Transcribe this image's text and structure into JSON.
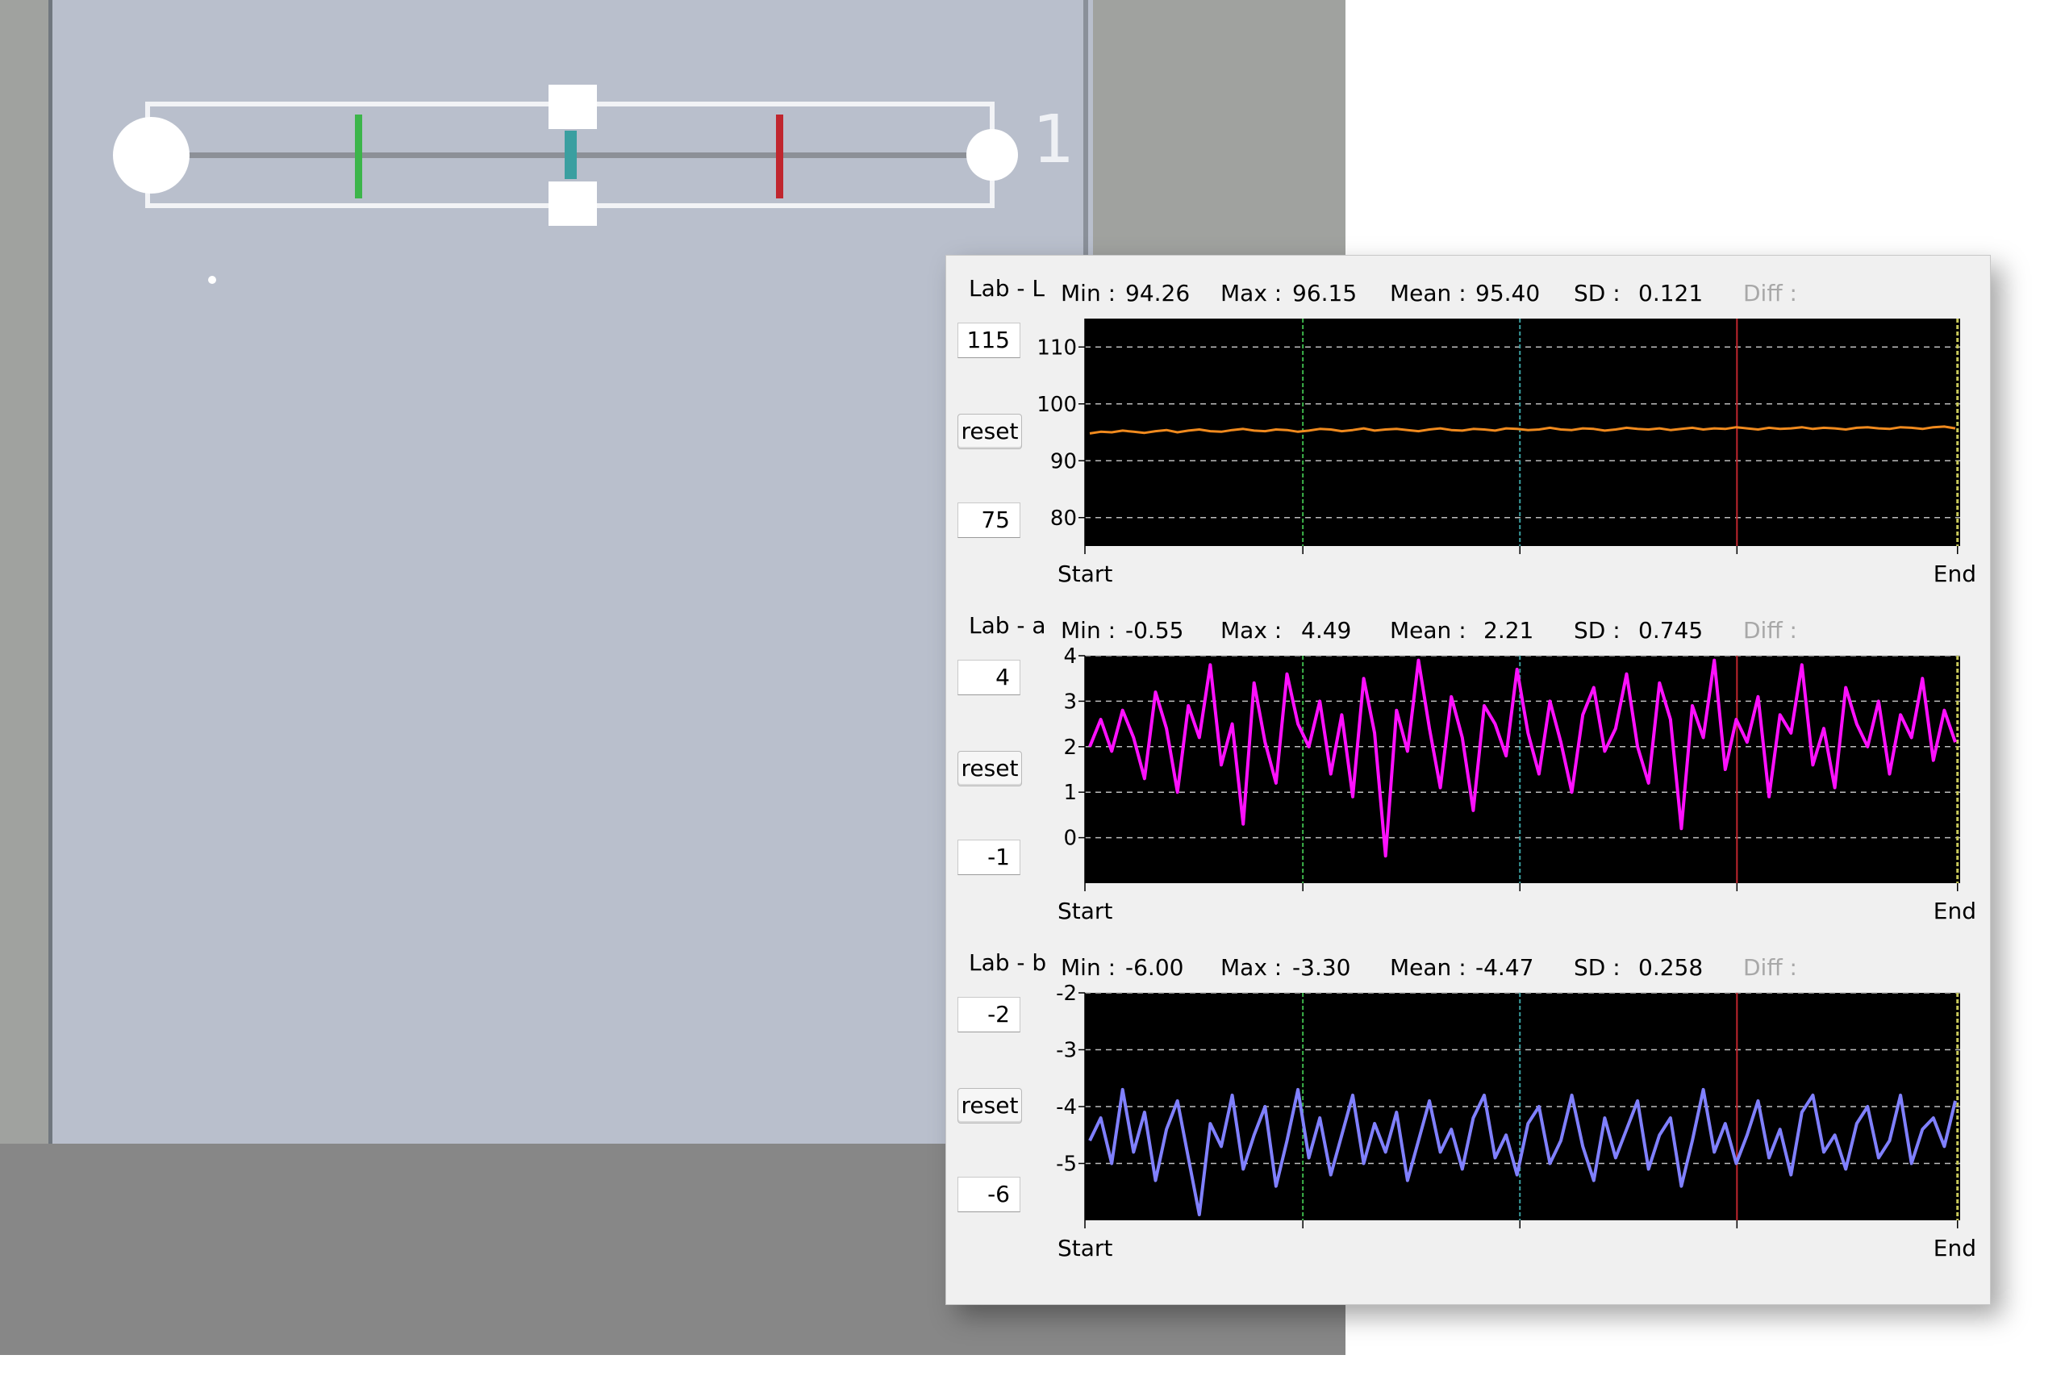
{
  "colors": {
    "plot_bg": "#000000",
    "grid": "#bdbdbd",
    "marker_green": "#3cb54a",
    "marker_teal": "#3a9fa0",
    "marker_red": "#c0262e",
    "marker_end": "#c8c85a",
    "series_L": "#f08a1e",
    "series_a": "#ff10ff",
    "series_b": "#8080ff"
  },
  "slider": {
    "value_label": "1"
  },
  "labels": {
    "min": "Min :",
    "max": "Max :",
    "mean": "Mean :",
    "sd": "SD :",
    "diff": "Diff :",
    "reset": "reset",
    "start": "Start",
    "end": "End"
  },
  "chart_data": [
    {
      "type": "line",
      "title": "Lab - L",
      "color": "#f08a1e",
      "stats": {
        "min": "94.26",
        "max": "96.15",
        "mean": "95.40",
        "sd": "0.121"
      },
      "upper_input": "115",
      "lower_input": "75",
      "ylim": [
        75,
        115
      ],
      "ticks": [
        "110",
        "100",
        "90",
        "80"
      ],
      "x_labels": [
        "Start",
        "End"
      ],
      "y": [
        94.8,
        95.1,
        95.0,
        95.3,
        95.1,
        94.9,
        95.2,
        95.4,
        95.0,
        95.3,
        95.5,
        95.2,
        95.1,
        95.4,
        95.6,
        95.3,
        95.2,
        95.5,
        95.4,
        95.1,
        95.3,
        95.6,
        95.5,
        95.2,
        95.4,
        95.7,
        95.3,
        95.5,
        95.6,
        95.4,
        95.2,
        95.5,
        95.7,
        95.4,
        95.3,
        95.6,
        95.5,
        95.3,
        95.7,
        95.6,
        95.4,
        95.5,
        95.8,
        95.5,
        95.4,
        95.7,
        95.6,
        95.3,
        95.5,
        95.8,
        95.6,
        95.5,
        95.7,
        95.4,
        95.6,
        95.8,
        95.5,
        95.7,
        95.6,
        95.9,
        95.7,
        95.5,
        95.8,
        95.6,
        95.7,
        95.9,
        95.6,
        95.8,
        95.7,
        95.5,
        95.8,
        95.9,
        95.7,
        95.6,
        95.9,
        95.8,
        95.6,
        95.9,
        96.0,
        95.7
      ]
    },
    {
      "type": "line",
      "title": "Lab - a",
      "color": "#ff10ff",
      "stats": {
        "min": "-0.55",
        "max": "4.49",
        "mean": "2.21",
        "sd": "0.745"
      },
      "upper_input": "4",
      "lower_input": "-1",
      "ylim": [
        -1,
        4
      ],
      "ticks": [
        "4",
        "3",
        "2",
        "1",
        "0"
      ],
      "x_labels": [
        "Start",
        "End"
      ],
      "y": [
        2.0,
        2.6,
        1.9,
        2.8,
        2.2,
        1.3,
        3.2,
        2.4,
        1.0,
        2.9,
        2.2,
        3.8,
        1.6,
        2.5,
        0.3,
        3.4,
        2.1,
        1.2,
        3.6,
        2.5,
        2.0,
        3.0,
        1.4,
        2.7,
        0.9,
        3.5,
        2.3,
        -0.4,
        2.8,
        1.9,
        3.9,
        2.4,
        1.1,
        3.1,
        2.2,
        0.6,
        2.9,
        2.5,
        1.8,
        3.7,
        2.3,
        1.4,
        3.0,
        2.1,
        1.0,
        2.7,
        3.3,
        1.9,
        2.4,
        3.6,
        2.0,
        1.2,
        3.4,
        2.6,
        0.2,
        2.9,
        2.2,
        3.9,
        1.5,
        2.6,
        2.1,
        3.1,
        0.9,
        2.7,
        2.3,
        3.8,
        1.6,
        2.4,
        1.1,
        3.3,
        2.5,
        2.0,
        3.0,
        1.4,
        2.7,
        2.2,
        3.5,
        1.7,
        2.8,
        2.1
      ]
    },
    {
      "type": "line",
      "title": "Lab - b",
      "color": "#8080ff",
      "stats": {
        "min": "-6.00",
        "max": "-3.30",
        "mean": "-4.47",
        "sd": "0.258"
      },
      "upper_input": "-2",
      "lower_input": "-6",
      "ylim": [
        -6,
        -2
      ],
      "ticks": [
        "-2",
        "-3",
        "-4",
        "-5"
      ],
      "x_labels": [
        "Start",
        "End"
      ],
      "y": [
        -4.6,
        -4.2,
        -5.0,
        -3.7,
        -4.8,
        -4.1,
        -5.3,
        -4.4,
        -3.9,
        -4.9,
        -5.9,
        -4.3,
        -4.7,
        -3.8,
        -5.1,
        -4.5,
        -4.0,
        -5.4,
        -4.6,
        -3.7,
        -4.9,
        -4.2,
        -5.2,
        -4.5,
        -3.8,
        -5.0,
        -4.3,
        -4.8,
        -4.1,
        -5.3,
        -4.6,
        -3.9,
        -4.8,
        -4.4,
        -5.1,
        -4.2,
        -3.8,
        -4.9,
        -4.5,
        -5.2,
        -4.3,
        -4.0,
        -5.0,
        -4.6,
        -3.8,
        -4.7,
        -5.3,
        -4.2,
        -4.9,
        -4.4,
        -3.9,
        -5.1,
        -4.5,
        -4.2,
        -5.4,
        -4.6,
        -3.7,
        -4.8,
        -4.3,
        -5.0,
        -4.5,
        -3.9,
        -4.9,
        -4.4,
        -5.2,
        -4.1,
        -3.8,
        -4.8,
        -4.5,
        -5.1,
        -4.3,
        -4.0,
        -4.9,
        -4.6,
        -3.8,
        -5.0,
        -4.4,
        -4.2,
        -4.7,
        -3.9
      ]
    }
  ]
}
